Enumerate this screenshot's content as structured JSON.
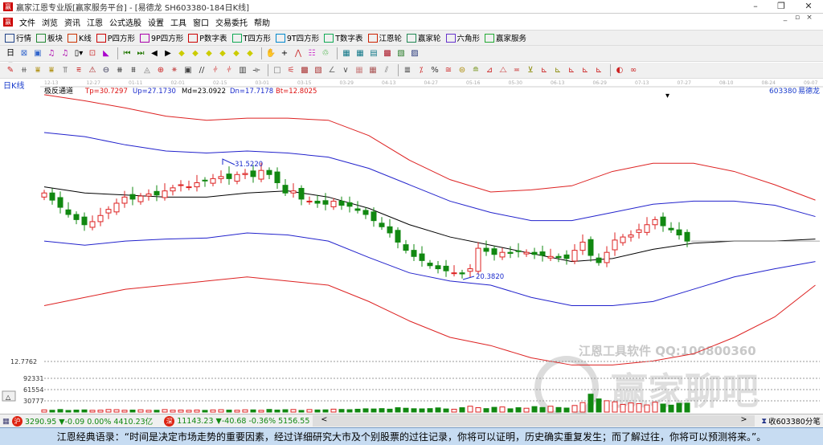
{
  "window": {
    "title": "赢家江恩专业版[赢家服务平台] - [易德龙  SH603380-184日K线]",
    "min": "–",
    "restore": "❐",
    "close": "✕"
  },
  "menu": [
    "文件",
    "浏览",
    "资讯",
    "江恩",
    "公式选股",
    "设置",
    "工具",
    "窗口",
    "交易委托",
    "帮助"
  ],
  "toolbar1": [
    {
      "label": "行情",
      "icon": "grid-icon",
      "color": "#224488"
    },
    {
      "label": "板块",
      "icon": "blocks-icon",
      "color": "#228833"
    },
    {
      "label": "K线",
      "icon": "kline-icon",
      "color": "#cc3300"
    },
    {
      "label": "P四方形",
      "icon": "P4",
      "color": "#cc0000"
    },
    {
      "label": "9P四方形",
      "icon": "P9",
      "color": "#aa00aa"
    },
    {
      "label": "P数字表",
      "icon": "PN",
      "color": "#cc0000"
    },
    {
      "label": "T四方形",
      "icon": "T4",
      "color": "#11aa55"
    },
    {
      "label": "9T四方形",
      "icon": "T9",
      "color": "#0088cc"
    },
    {
      "label": "T数字表",
      "icon": "TN",
      "color": "#11aa55"
    },
    {
      "label": "江恩轮",
      "icon": "wheel-icon",
      "color": "#cc2200"
    },
    {
      "label": "赢家轮",
      "icon": "wheel2-icon",
      "color": "#228855"
    },
    {
      "label": "六角形",
      "icon": "hexagon-icon",
      "color": "#6633cc"
    },
    {
      "label": "赢家服务",
      "icon": "dollar-icon",
      "color": "#22aa33"
    }
  ],
  "chart": {
    "period_label": "日K线",
    "dates": [
      "12-13",
      "12-27",
      "01-11",
      "02-01",
      "02-15",
      "03-01",
      "03-15",
      "03-29",
      "04-13",
      "04-27",
      "05-16",
      "05-30",
      "06-13",
      "06-29",
      "07-13",
      "07-27",
      "08-10",
      "08-24",
      "09-07"
    ],
    "indicator": {
      "name": "极反通道",
      "tp": "Tp=30.7297",
      "up": "Up=27.1730",
      "md": "Md=23.0922",
      "dn": "Dn=17.7178",
      "bt": "Bt=12.8025"
    },
    "stock": "603380",
    "stock_name": "易德龙",
    "high_label": "31.5220",
    "low_label": "20.3820",
    "axis_label": "12.7762",
    "vol_ticks": [
      "92331",
      "61554",
      "30777"
    ],
    "watermark1": "江恩工具软件  QQ:100800360",
    "watermark2": "赢家聊吧"
  },
  "chart_data": {
    "type": "candlestick",
    "closes": [
      28.6,
      27.9,
      27.2,
      26.5,
      26.0,
      25.5,
      25.8,
      26.4,
      27.0,
      27.6,
      28.2,
      28.0,
      28.3,
      28.5,
      28.4,
      28.8,
      29.1,
      29.4,
      29.2,
      29.6,
      29.8,
      30.0,
      30.2,
      30.0,
      30.4,
      30.5,
      30.2,
      30.8,
      30.4,
      29.6,
      28.6,
      28.8,
      28.0,
      27.8,
      27.6,
      27.5,
      27.8,
      27.4,
      27.3,
      26.9,
      26.5,
      25.9,
      25.3,
      24.7,
      23.8,
      23.0,
      22.4,
      22.0,
      21.5,
      21.2,
      21.0,
      20.8,
      20.7,
      21.2,
      23.2,
      22.9,
      22.6,
      22.8,
      22.7,
      22.9,
      22.8,
      22.6,
      22.5,
      22.4,
      22.3,
      22.2,
      23.0,
      23.8,
      22.5,
      21.8,
      22.8,
      24.0,
      24.3,
      24.5,
      25.0,
      25.5,
      26.0,
      25.4,
      25.0,
      24.5,
      23.9
    ],
    "volumes": [
      6000,
      5000,
      7000,
      4500,
      5500,
      6000,
      4800,
      5200,
      7000,
      6500,
      5000,
      5500,
      6200,
      4800,
      5000,
      6800,
      5200,
      5500,
      4900,
      5600,
      4700,
      5800,
      6500,
      5400,
      5000,
      6200,
      6000,
      4800,
      7200,
      5600,
      6500,
      7000,
      4500,
      6900,
      5800,
      6100,
      8000,
      7200,
      6500,
      7800,
      9000,
      8500,
      9500,
      8000,
      12000,
      10500,
      9200,
      8800,
      9500,
      11500,
      8600,
      7800,
      12000,
      16000,
      12000,
      9500,
      13000,
      14000,
      9000,
      12000,
      10500,
      15000,
      12500,
      16000,
      12500,
      11000,
      18000,
      26000,
      49000,
      36000,
      31000,
      28000,
      21000,
      25000,
      23000,
      19500,
      27000,
      22000,
      19000,
      24000,
      24500
    ],
    "bands": {
      "top": [
        38.2,
        37.6,
        36.9,
        36.1,
        35.7,
        35.9,
        35.9,
        35.7,
        34.2,
        31.8,
        29.9,
        28.7,
        28.9,
        29.3,
        30.7,
        31.5,
        31.5,
        30.7,
        29.4,
        27.9
      ],
      "up": [
        34.5,
        34.1,
        33.3,
        32.7,
        32.5,
        32.7,
        32.5,
        32.1,
        31.0,
        29.4,
        27.8,
        26.7,
        25.9,
        25.9,
        26.7,
        27.5,
        27.8,
        27.8,
        27.4,
        26.3
      ],
      "mid": [
        29.2,
        28.6,
        28.4,
        28.2,
        28.2,
        28.6,
        28.8,
        28.2,
        27.1,
        25.5,
        24.3,
        23.5,
        22.7,
        21.9,
        22.2,
        23.1,
        23.7,
        23.9,
        23.9,
        24.1
      ],
      "dn": [
        23.9,
        23.5,
        23.9,
        24.1,
        24.2,
        24.7,
        24.5,
        23.9,
        22.3,
        20.8,
        20.0,
        19.6,
        18.4,
        17.6,
        17.6,
        18.0,
        19.2,
        20.4,
        21.2,
        21.9
      ],
      "bottom": [
        17.6,
        18.4,
        19.2,
        19.6,
        20.0,
        20.4,
        20.0,
        19.6,
        18.0,
        16.1,
        14.5,
        13.7,
        12.5,
        11.8,
        11.8,
        12.2,
        12.9,
        14.5,
        16.5,
        19.6
      ]
    },
    "band_colors": {
      "top": "#dd2222",
      "up": "#2222cc",
      "mid": "#000000",
      "dn": "#2222cc",
      "bottom": "#dd2222"
    },
    "up_color": "#dd2222",
    "down_color": "#118811"
  },
  "status": {
    "sh_badge": "沪",
    "sh_quote": "3290.95 ▼-0.09 0.00% 4410.23亿",
    "sz_badge": "深",
    "sz_quote": "11143.23 ▼-40.68 -0.36% 5156.55",
    "left_arrow": "<",
    "right_arrow": ">",
    "right_text": "收603380分笔"
  },
  "quote": "江恩经典语录：“时间是决定市场走势的重要因素，经过详细研究大市及个别股票的过往记录，你将可以证明，历史确实重复发生；而了解过往，你将可以预测将来。”。"
}
